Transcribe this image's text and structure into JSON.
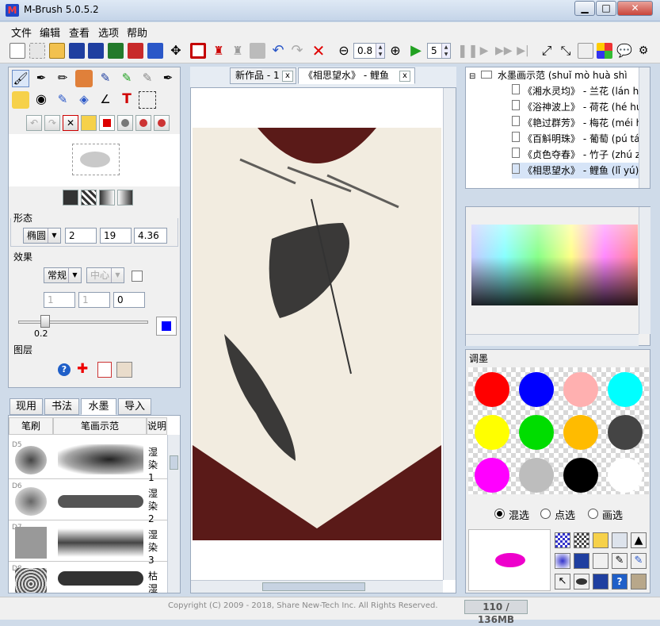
{
  "window": {
    "title": "M-Brush 5.0.5.2",
    "app_icon_glyph": "M",
    "buttons": {
      "minimize": "▁",
      "maximize": "□",
      "close": "✕"
    }
  },
  "menu": [
    "文件",
    "编辑",
    "查看",
    "选项",
    "帮助"
  ],
  "toolbar": {
    "zoom_value": "0.8",
    "speed_value": "5"
  },
  "brush_panel": {
    "shape_label": "形态",
    "shape_type": "椭圆",
    "shape_v1": "2",
    "shape_v2": "19",
    "shape_v3": "4.36",
    "effect_label": "效果",
    "effect_mode": "常规",
    "effect_center": "中心",
    "effect_v1": "1",
    "effect_v2": "1",
    "effect_v3": "0",
    "slider_value": "0.2",
    "layer_label": "图层"
  },
  "library": {
    "tabs": [
      "现用",
      "书法",
      "水墨",
      "导入"
    ],
    "selected_tab": "水墨",
    "columns": [
      "笔刷",
      "笔画示范",
      "说明"
    ],
    "rows": [
      {
        "id": "D5",
        "desc": "湿染 1"
      },
      {
        "id": "D6",
        "desc": "湿染 2"
      },
      {
        "id": "D7",
        "desc": "湿染 3"
      },
      {
        "id": "D8",
        "desc": "枯湿 1"
      }
    ]
  },
  "documents": {
    "tabs": [
      {
        "label": "新作品 - 1",
        "close": "x",
        "active": false
      },
      {
        "label": "《相思望水》 - 鲤鱼",
        "close": "x",
        "active": true
      }
    ]
  },
  "tree": {
    "root": "水墨画示范 (shuǐ mò huà shì",
    "items": [
      "《湘水灵均》 - 兰花 (lán h",
      "《浴神波上》 - 荷花 (hé hu",
      "《艳过群芳》 - 梅花 (méi h",
      "《百斛明珠》 - 葡萄 (pú tá",
      "《贞色夺春》 - 竹子 (zhú z",
      "《相思望水》 - 鲤鱼 (lǐ yú)"
    ],
    "selected_index": 5
  },
  "mixer": {
    "label": "调墨",
    "swatches": [
      "#ff0000",
      "#0000ff",
      "#ffb0b0",
      "#00ffff",
      "#ffff00",
      "#00dd00",
      "#ffbb00",
      "#444444",
      "#ff00ff",
      "#bdbdbd",
      "#000000",
      "#ffffff"
    ],
    "radios": [
      "混选",
      "点选",
      "画选"
    ],
    "selected_radio": "混选",
    "preview_color": "#ee00cc"
  },
  "status": {
    "copyright": "Copyright (C) 2009 - 2018, Share New-Tech Inc.  All Rights Reserved.",
    "memory": "110 / 136MB"
  },
  "colors": {
    "accent_blue": "#0000ff",
    "delete_red": "#e00000",
    "play_green": "#21a121"
  }
}
